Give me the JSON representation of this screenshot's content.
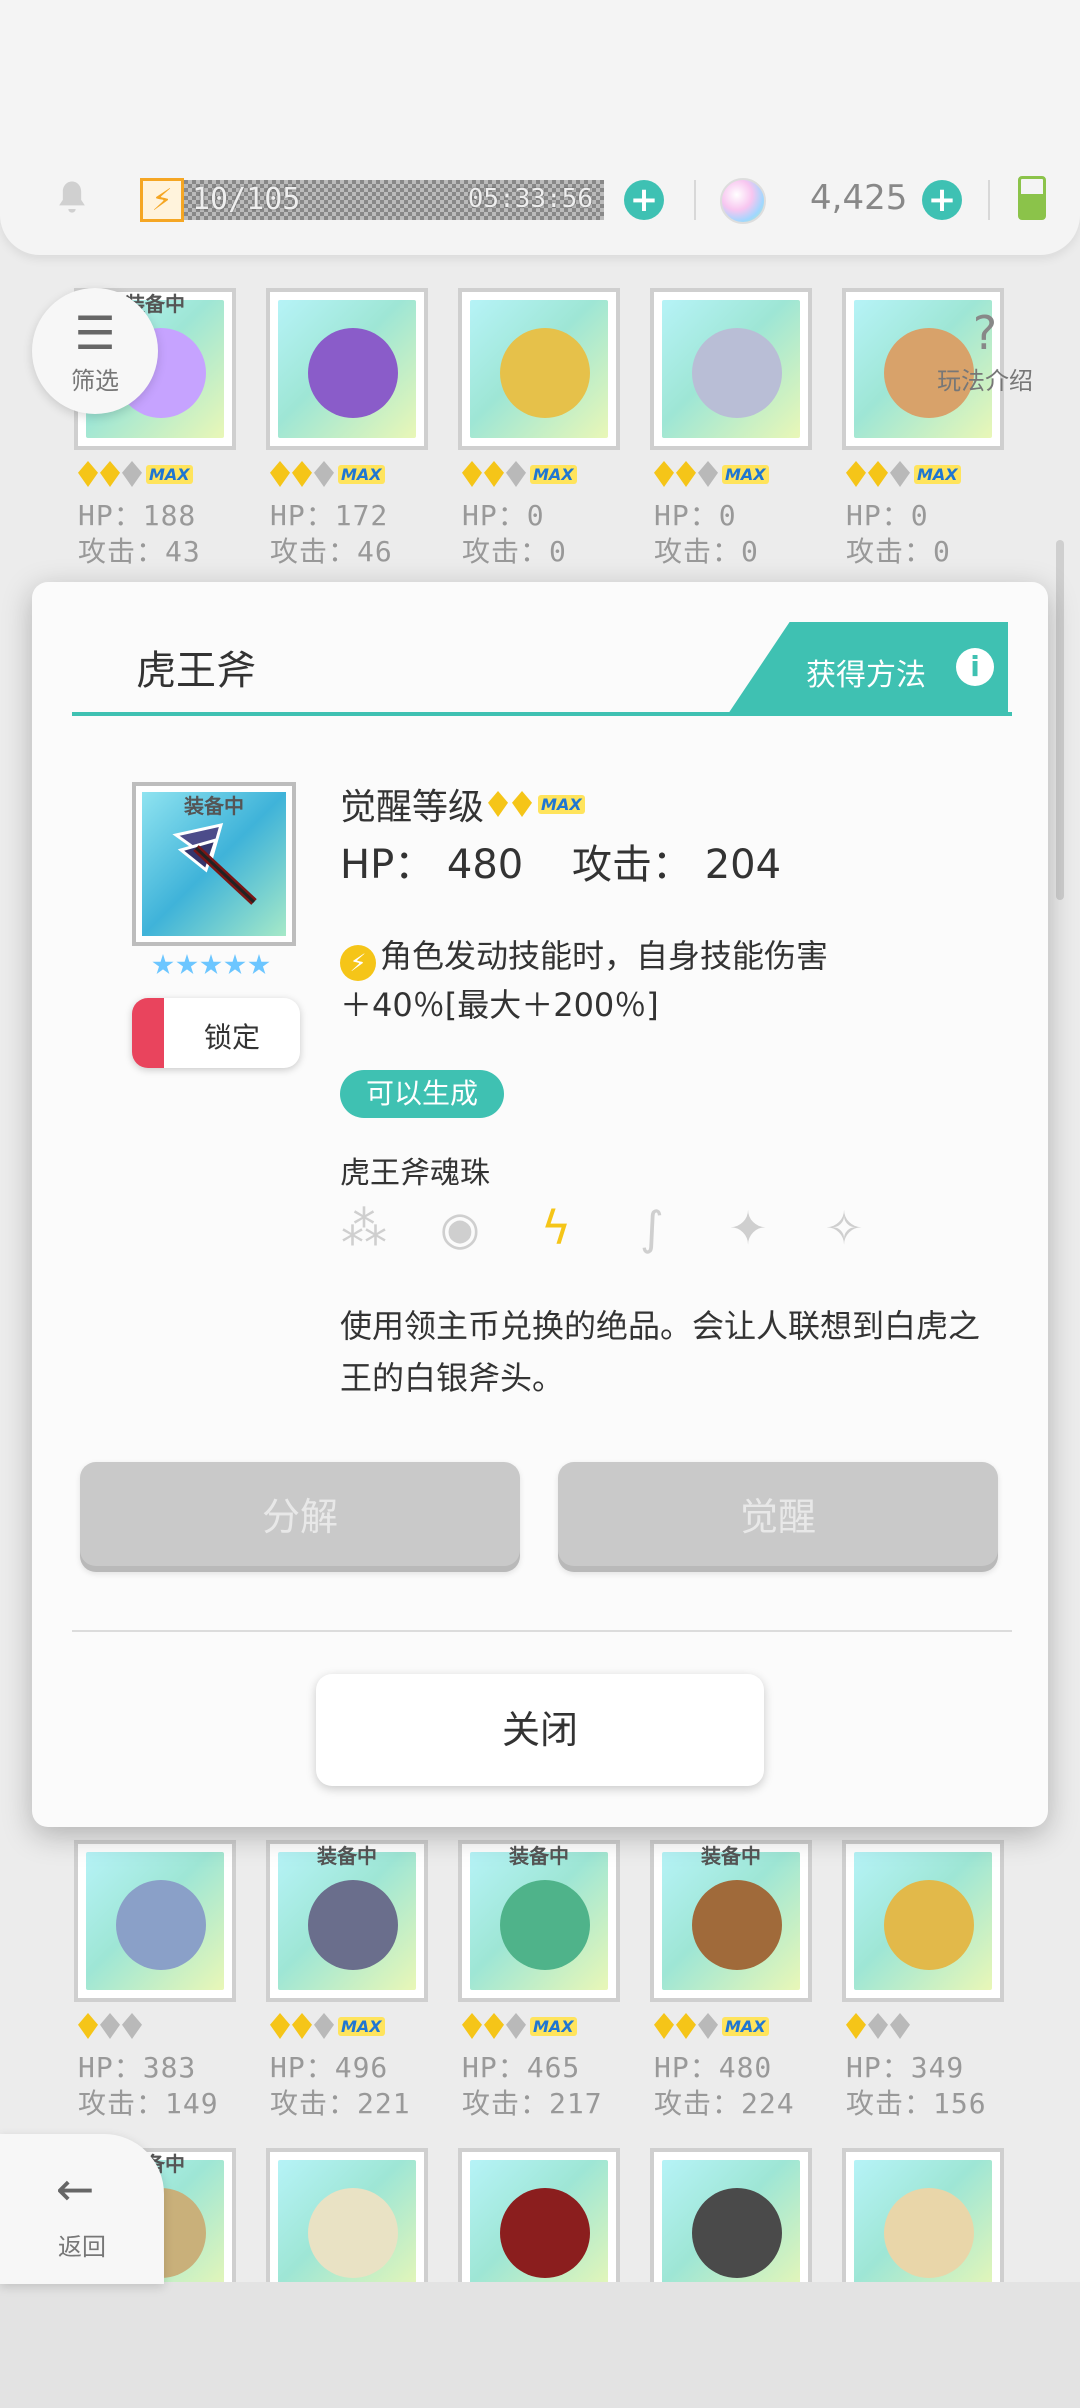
{
  "header": {
    "energy_value": "10/105",
    "energy_timer": "05:33:56",
    "gem_count": "4,425"
  },
  "floats": {
    "filter_label": "筛选",
    "guide_label": "玩法介绍",
    "back_label": "返回"
  },
  "grid_top": [
    {
      "badge": "装备中",
      "hp": "HP：188",
      "atk": "攻击：43",
      "awaken": 2,
      "max": true
    },
    {
      "badge": "",
      "hp": "HP：172",
      "atk": "攻击：46",
      "awaken": 2,
      "max": true
    },
    {
      "badge": "",
      "hp": "HP：0",
      "atk": "攻击：0",
      "awaken": 2,
      "max": true
    },
    {
      "badge": "",
      "hp": "HP：0",
      "atk": "攻击：0",
      "awaken": 2,
      "max": true
    },
    {
      "badge": "",
      "hp": "HP：0",
      "atk": "攻击：0",
      "awaken": 2,
      "max": true
    }
  ],
  "grid_bottom": [
    {
      "badge": "",
      "hp": "HP：383",
      "atk": "攻击：149",
      "awaken": 1,
      "max": false
    },
    {
      "badge": "装备中",
      "hp": "HP：496",
      "atk": "攻击：221",
      "awaken": 2,
      "max": true
    },
    {
      "badge": "装备中",
      "hp": "HP：465",
      "atk": "攻击：217",
      "awaken": 2,
      "max": true
    },
    {
      "badge": "装备中",
      "hp": "HP：480",
      "atk": "攻击：224",
      "awaken": 2,
      "max": true
    },
    {
      "badge": "",
      "hp": "HP：349",
      "atk": "攻击：156",
      "awaken": 1,
      "max": false
    }
  ],
  "grid_third_badge": "装备中",
  "modal": {
    "title": "虎王斧",
    "obtain_label": "获得方法",
    "info_glyph": "i",
    "item_badge": "装备中",
    "lock_label": "锁定",
    "awaken_label": "觉醒等级",
    "max_label": "MAX",
    "hp_text": "HP： 480",
    "atk_text": "攻击： 204",
    "skill_line1": "角色发动技能时，自身技能伤害",
    "skill_line2": "＋40％[最大＋200％]",
    "can_make": "可以生成",
    "soul_orb": "虎王斧魂珠",
    "description": "使用领主币兑换的绝品。会让人联想到白虎之王的白银斧头。",
    "decompose": "分解",
    "awaken": "觉醒",
    "close": "关闭"
  },
  "colors": {
    "accent": "#3fc1b2",
    "lock_red": "#e9445d",
    "gold": "#f5c518"
  }
}
